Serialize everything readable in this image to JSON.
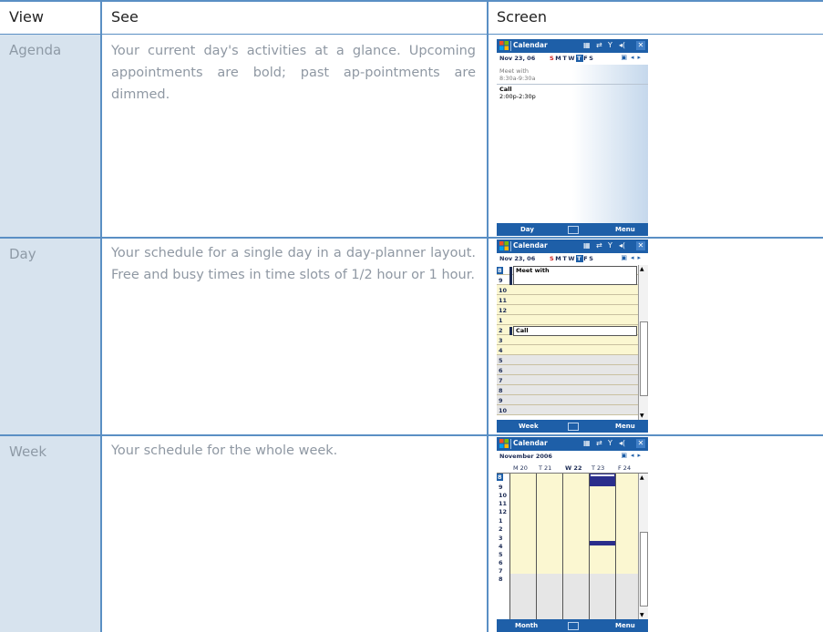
{
  "table": {
    "headers": {
      "view": "View",
      "see": "See",
      "screen": "Screen"
    },
    "rows": [
      {
        "view": "Agenda",
        "see": "Your current day's activities at a glance. Upcoming appointments are bold; past ap-pointments are dimmed."
      },
      {
        "view": "Day",
        "see": "Your schedule for a single day in a day-planner layout. Free and busy times in time slots of 1/2 hour or 1 hour."
      },
      {
        "view": "Week",
        "see": "Your schedule for the whole week."
      }
    ]
  },
  "screens": {
    "agenda": {
      "title": "Calendar",
      "date": "Nov 23, 06",
      "days": "S M T W T F S",
      "items": [
        {
          "name": "Meet with",
          "time": "8:30a-9:30a"
        },
        {
          "name": "Call",
          "time": "2:00p-2:30p"
        }
      ],
      "left_softkey": "Day",
      "right_softkey": "Menu"
    },
    "day": {
      "title": "Calendar",
      "date": "Nov 23, 06",
      "days": "S M T W T F S",
      "hours": [
        "8",
        "9",
        "10",
        "11",
        "12",
        "1",
        "2",
        "3",
        "4",
        "5",
        "6",
        "7",
        "8",
        "9",
        "10"
      ],
      "appointments": [
        "Meet with",
        "Call"
      ],
      "left_softkey": "Week",
      "right_softkey": "Menu"
    },
    "week": {
      "title": "Calendar",
      "month": "November 2006",
      "columns": [
        "M 20",
        "T 21",
        "W 22",
        "T 23",
        "F 24"
      ],
      "hours": [
        "8",
        "9",
        "10",
        "11",
        "12",
        "1",
        "2",
        "3",
        "4",
        "5",
        "6",
        "7",
        "8"
      ],
      "left_softkey": "Month",
      "right_softkey": "Menu"
    }
  },
  "colors": {
    "accent": "#1e5fa8",
    "rule": "#5a8fc4",
    "view_col": "#d7e3ee",
    "busy": "#2a2e8c",
    "workhours": "#fbf7d1"
  }
}
